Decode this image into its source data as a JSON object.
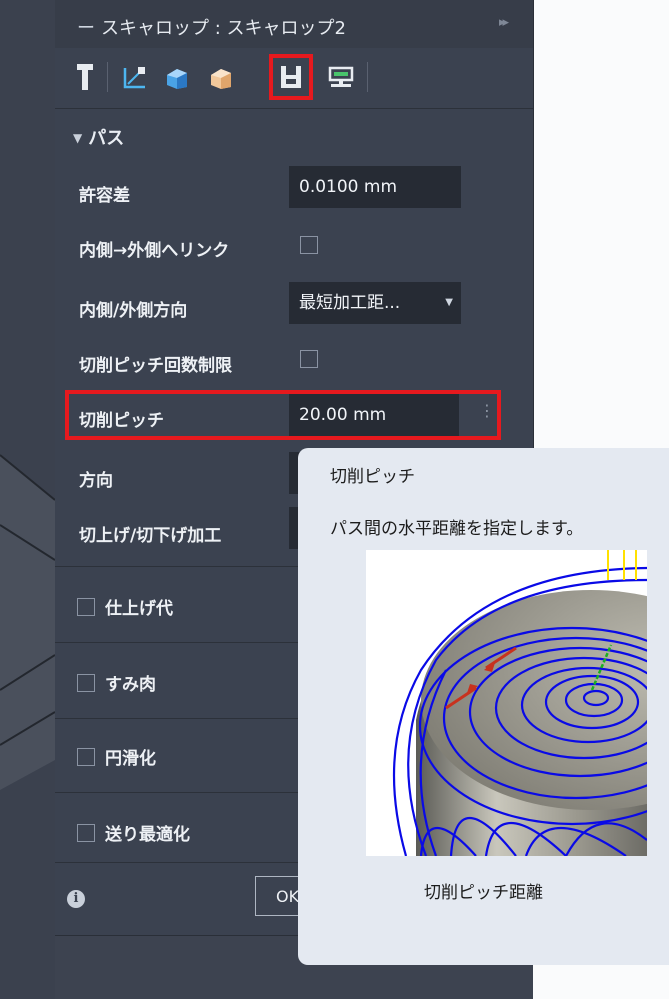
{
  "panel": {
    "title": "スキャロップ : スキャロップ2",
    "title_dash": "ー",
    "title_arrows": "▸▸"
  },
  "toolbar": {
    "tools": [
      {
        "name": "tool-icon",
        "selected": false
      },
      {
        "name": "geometry-icon",
        "selected": false
      },
      {
        "name": "heights-icon",
        "selected": false
      },
      {
        "name": "passes-icon",
        "selected": false
      },
      {
        "name": "linking-icon",
        "selected": true
      },
      {
        "name": "multi-axis-icon",
        "selected": false
      }
    ]
  },
  "section": {
    "caret": "▼",
    "title": "パス"
  },
  "rows": {
    "tolerance": {
      "label": "許容差",
      "value": "0.0100 mm"
    },
    "inside_out": {
      "label": "内側→外側へリンク"
    },
    "direction_inout": {
      "label": "内側/外側方向",
      "value": "最短加工距..."
    },
    "limit_stepovers": {
      "label": "切削ピッチ回数制限"
    },
    "stepover": {
      "label": "切削ピッチ",
      "value": "20.00 mm",
      "kebab": "⋮"
    },
    "direction": {
      "label": "方向"
    },
    "climb": {
      "label": "切上げ/切下げ加工"
    }
  },
  "groups": {
    "stock_to_leave": "仕上げ代",
    "fillet": "すみ肉",
    "smoothing": "円滑化",
    "feed_optimization": "送り最適化"
  },
  "footer": {
    "info": "i",
    "ok": "OK"
  },
  "tooltip": {
    "title": "切削ピッチ",
    "description": "パス間の水平距離を指定します。",
    "caption": "切削ピッチ距離"
  }
}
